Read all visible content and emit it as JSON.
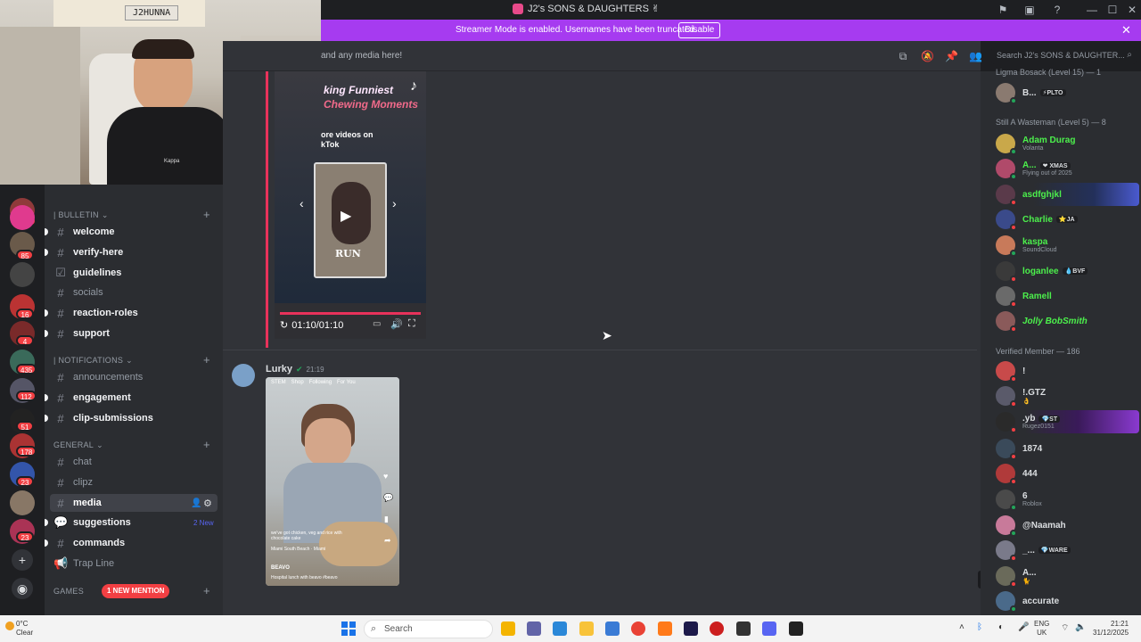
{
  "window": {
    "title": "J2's SONS & DAUGHTERS ✌"
  },
  "banner": {
    "text": "Streamer Mode is enabled. Usernames have been truncated.",
    "button": "Disable"
  },
  "webcam": {
    "overlay_name": "J2HUNNA",
    "shirt_text": "Kappa"
  },
  "rail_badges": [
    "112",
    "85",
    "16",
    "4",
    "435",
    "112",
    "51",
    "178",
    "23",
    "23"
  ],
  "sidebar": {
    "categories": [
      {
        "label": "| BULLETIN",
        "channels": [
          {
            "name": "welcome",
            "state": "unread"
          },
          {
            "name": "verify-here",
            "state": "unread"
          },
          {
            "name": "guidelines",
            "state": "unread",
            "icon": "rules"
          },
          {
            "name": "socials",
            "state": "read"
          },
          {
            "name": "reaction-roles",
            "state": "unread"
          },
          {
            "name": "support",
            "state": "unread"
          }
        ]
      },
      {
        "label": "| NOTIFICATIONS",
        "channels": [
          {
            "name": "announcements",
            "state": "read"
          },
          {
            "name": "engagement",
            "state": "unread"
          },
          {
            "name": "clip-submissions",
            "state": "unread"
          }
        ]
      },
      {
        "label": "GENERAL",
        "channels": [
          {
            "name": "chat",
            "state": "read"
          },
          {
            "name": "clipz",
            "state": "read"
          },
          {
            "name": "media",
            "state": "active"
          },
          {
            "name": "suggestions",
            "state": "unread",
            "badge": "2 New"
          },
          {
            "name": "commands",
            "state": "unread"
          },
          {
            "name": "Trap Line",
            "state": "read"
          }
        ]
      },
      {
        "label": "GAMES",
        "channels": []
      }
    ],
    "mention_pill": "1 NEW MENTION"
  },
  "chat_header": {
    "topic": "and any media here!",
    "search_placeholder": "Search J2's SONS & DAUGHTER..."
  },
  "messages": [
    {
      "video_overlay": {
        "title_lines": [
          "king Funniest",
          "Chewing Moments"
        ],
        "more_text": "ore videos on",
        "more_text2": "kTok",
        "run_label": "RUN",
        "time": "01:10/01:10"
      }
    },
    {
      "author": "Lurky",
      "time": "21:19",
      "tiktok_tabs": [
        "STEM",
        "Shop",
        "Following",
        "For You"
      ],
      "caption": "we've got chicken, veg and rice with chocolate cake",
      "location": "Miami South Beach · Miami",
      "footer": "Hospital lunch with beavo #beavo",
      "brand": "BEAVO"
    }
  ],
  "members": {
    "groups": [
      {
        "label": "Ligma Bosack (Level 15) — 1",
        "members": [
          {
            "name": "B...",
            "tag": "⚡PLTO",
            "color": "#dbdee1"
          }
        ]
      },
      {
        "label": "Still A Wasteman (Level 5) — 8",
        "members": [
          {
            "name": "Adam Durag",
            "activity": "Volanta",
            "color": "#4cf04c"
          },
          {
            "name": "A...",
            "tag": "❤ XMAS",
            "activity": "Flying out of 2025",
            "color": "#4cf04c"
          },
          {
            "name": "asdfghjkl",
            "color": "#4cf04c"
          },
          {
            "name": "Charlie",
            "tag": "⭐JA",
            "color": "#4cf04c"
          },
          {
            "name": "kaspa",
            "activity": "SoundCloud",
            "color": "#4cf04c"
          },
          {
            "name": "loganlee",
            "tag": "💧BVF",
            "color": "#4cf04c"
          },
          {
            "name": "Ramell",
            "color": "#4cf04c"
          },
          {
            "name": "Jolly BobSmith",
            "color": "#4cf04c"
          }
        ]
      },
      {
        "label": "Verified Member — 186",
        "members": [
          {
            "name": "!",
            "color": "#dbdee1"
          },
          {
            "name": "!.GTZ",
            "activity": "👌",
            "color": "#dbdee1"
          },
          {
            "name": ".yb",
            "tag": "💎ST",
            "activity": "Rugez0151",
            "color": "#dbdee1"
          },
          {
            "name": "1874",
            "color": "#dbdee1"
          },
          {
            "name": "444",
            "color": "#dbdee1"
          },
          {
            "name": "6",
            "activity": "Roblox",
            "color": "#dbdee1"
          },
          {
            "name": "@Naamah",
            "color": "#dbdee1"
          },
          {
            "name": "_...",
            "tag": "💎WARE",
            "color": "#dbdee1"
          },
          {
            "name": "A...",
            "activity": "🐈",
            "color": "#dbdee1"
          },
          {
            "name": "accurate",
            "color": "#dbdee1"
          }
        ]
      }
    ]
  },
  "taskbar": {
    "weather_temp": "0°C",
    "weather_desc": "Clear",
    "search": "Search",
    "lang1": "ENG",
    "lang2": "UK",
    "time": "21:21",
    "date": "31/12/2025"
  },
  "colors": {
    "accent": "#a63bf0",
    "online": "#23a55a",
    "dnd": "#f23f43",
    "mention": "#f23f43"
  }
}
